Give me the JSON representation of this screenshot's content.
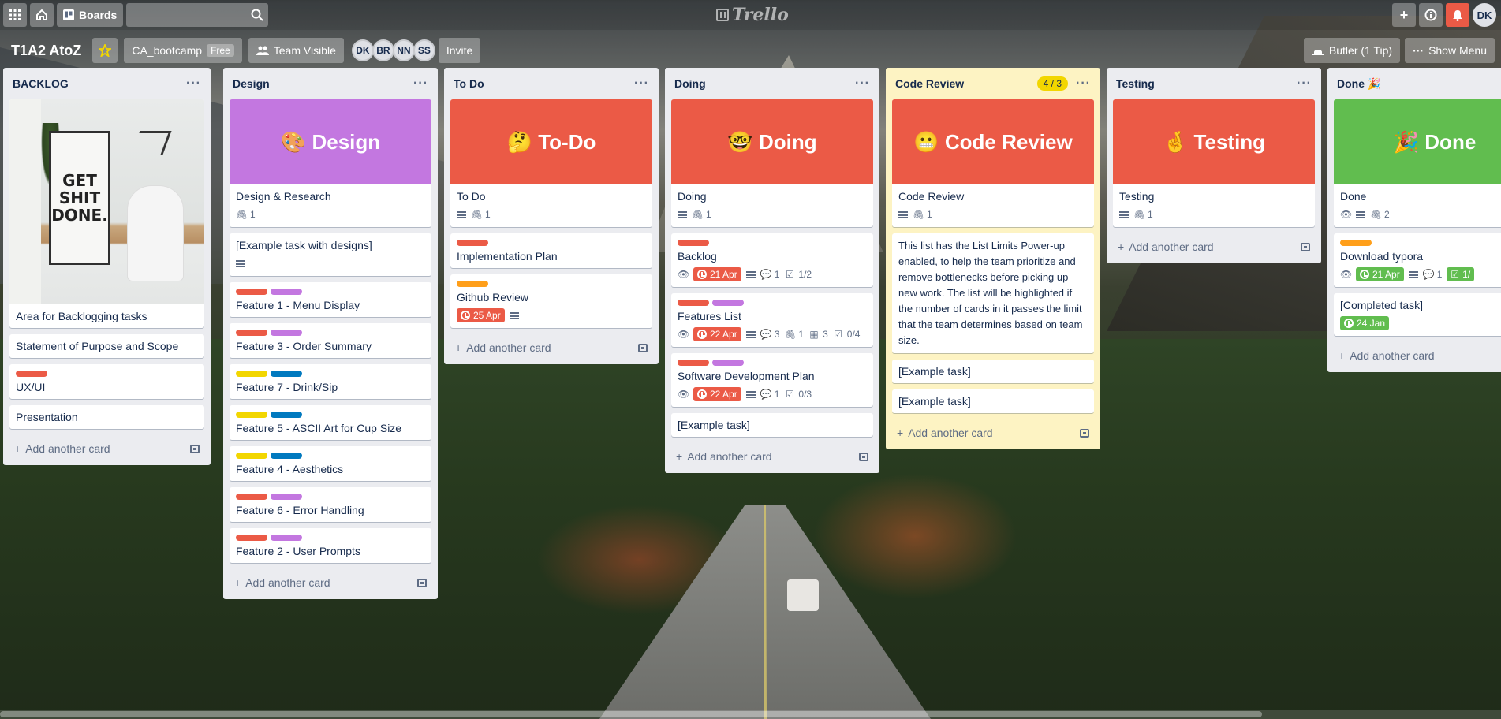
{
  "topbar": {
    "boards_label": "Boards",
    "logo_text": "Trello",
    "user_initials": "DK"
  },
  "board": {
    "title": "T1A2 AtoZ",
    "team": "CA_bootcamp",
    "plan": "Free",
    "visibility": "Team Visible",
    "members": [
      "DK",
      "BR",
      "NN",
      "SS"
    ],
    "invite_label": "Invite",
    "butler_label": "Butler (1 Tip)",
    "menu_label": "Show Menu"
  },
  "add_card_label": "Add another card",
  "lists": {
    "backlog": {
      "name": "BACKLOG",
      "cards": [
        "Area for Backlogging tasks",
        "Statement of Purpose and Scope",
        "UX/UI",
        "Presentation"
      ],
      "poster_text": "GET SHIT DONE."
    },
    "design": {
      "name": "Design",
      "cover": "🎨 Design",
      "cards": [
        "Design & Research",
        "[Example task with designs]",
        "Feature 1 - Menu Display",
        "Feature 3 - Order Summary",
        "Feature 7 - Drink/Sip",
        "Feature 5 - ASCII Art for Cup Size",
        "Feature 4 - Aesthetics",
        "Feature 6 - Error Handling",
        "Feature 2 - User Prompts"
      ],
      "attach_count": "1"
    },
    "todo": {
      "name": "To Do",
      "cover": "🤔 To-Do",
      "cards": [
        "To Do",
        "Implementation Plan",
        "Github Review"
      ],
      "attach_count": "1",
      "github_due": "25 Apr"
    },
    "doing": {
      "name": "Doing",
      "cover": "🤓 Doing",
      "cards": [
        "Doing",
        "Backlog",
        "Features List",
        "Software Development Plan",
        "[Example task]"
      ],
      "attach_count": "1",
      "backlog": {
        "due": "21 Apr",
        "comments": "1",
        "checklist": "1/2"
      },
      "features": {
        "due": "22 Apr",
        "comments": "3",
        "attachments": "1",
        "cards": "3",
        "checklist": "0/4"
      },
      "sdp": {
        "due": "22 Apr",
        "comments": "1",
        "checklist": "0/3"
      }
    },
    "code_review": {
      "name": "Code Review",
      "limit": "4 / 3",
      "cover": "😬 Code Review",
      "cards": [
        "Code Review",
        "This list has the List Limits Power-up enabled, to help the team prioritize and remove bottlenecks before picking up new work. The list will be highlighted if the number of cards in it passes the limit that the team determines based on team size.",
        "[Example task]",
        "[Example task]"
      ],
      "attach_count": "1"
    },
    "testing": {
      "name": "Testing",
      "cover": "🤞 Testing",
      "cards": [
        "Testing"
      ],
      "attach_count": "1"
    },
    "done": {
      "name": "Done 🎉",
      "cover": "🎉 Done",
      "cards": [
        "Done",
        "Download typora",
        "[Completed task]"
      ],
      "attach_count": "2",
      "typora": {
        "due": "21 Apr",
        "comments": "1",
        "checklist": "1/"
      },
      "completed_due": "24 Jan"
    }
  }
}
